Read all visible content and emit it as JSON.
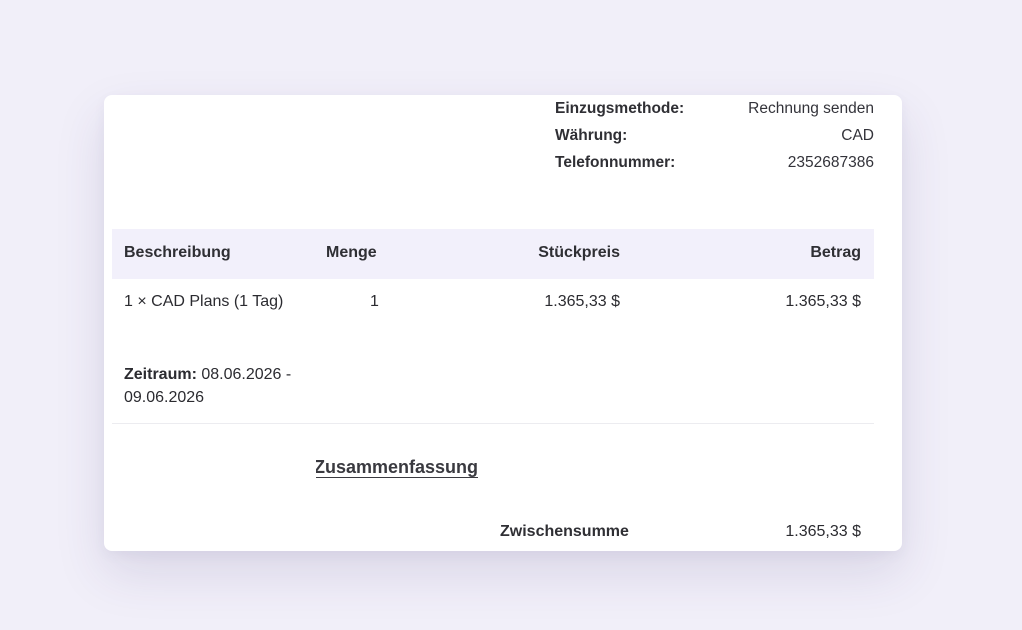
{
  "invoice_meta": [
    {
      "label": "Einzugsmethode:",
      "value": "Rechnung senden"
    },
    {
      "label": "Währung:",
      "value": "CAD"
    },
    {
      "label": "Telefonnummer:",
      "value": "2352687386"
    }
  ],
  "table": {
    "headers": {
      "description": "Beschreibung",
      "quantity": "Menge",
      "unit_price": "Stückpreis",
      "amount": "Betrag"
    },
    "rows": [
      {
        "description": "1 × CAD Plans (1 Tag)",
        "quantity": "1",
        "unit_price": "1.365,33 $",
        "amount": "1.365,33 $",
        "period_label": "Zeitraum:",
        "period_value": " 08.06.2026 - 09.06.2026"
      }
    ]
  },
  "summary": {
    "title": "Zusammenfassung",
    "subtotal_label": "Zwischensumme",
    "subtotal_value": "1.365,33 $"
  }
}
